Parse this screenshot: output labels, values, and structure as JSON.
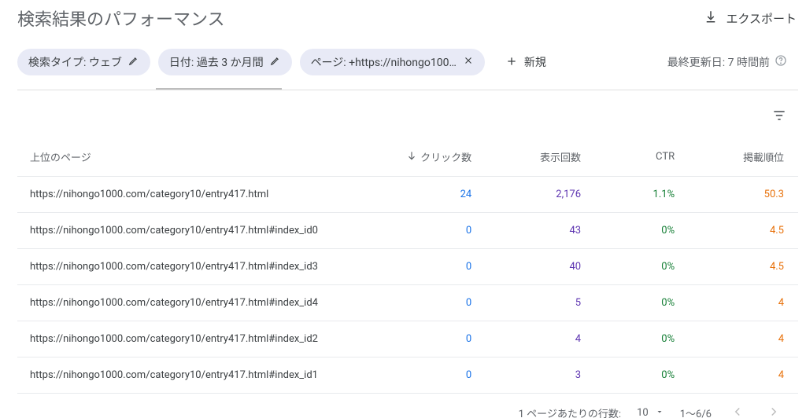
{
  "header": {
    "title": "検索結果のパフォーマンス",
    "export_label": "エクスポート"
  },
  "filters": {
    "search_type": "検索タイプ: ウェブ",
    "date_range": "日付: 過去 3 か月間",
    "page_filter": "ページ: +https://nihongo100…",
    "add_new": "新規",
    "last_updated": "最終更新日: 7 時間前"
  },
  "table": {
    "columns": {
      "page": "上位のページ",
      "clicks": "クリック数",
      "impressions": "表示回数",
      "ctr": "CTR",
      "position": "掲載順位"
    },
    "rows": [
      {
        "page": "https://nihongo1000.com/category10/entry417.html",
        "clicks": "24",
        "impressions": "2,176",
        "ctr": "1.1%",
        "position": "50.3"
      },
      {
        "page": "https://nihongo1000.com/category10/entry417.html#index_id0",
        "clicks": "0",
        "impressions": "43",
        "ctr": "0%",
        "position": "4.5"
      },
      {
        "page": "https://nihongo1000.com/category10/entry417.html#index_id3",
        "clicks": "0",
        "impressions": "40",
        "ctr": "0%",
        "position": "4.5"
      },
      {
        "page": "https://nihongo1000.com/category10/entry417.html#index_id4",
        "clicks": "0",
        "impressions": "5",
        "ctr": "0%",
        "position": "4"
      },
      {
        "page": "https://nihongo1000.com/category10/entry417.html#index_id2",
        "clicks": "0",
        "impressions": "4",
        "ctr": "0%",
        "position": "4"
      },
      {
        "page": "https://nihongo1000.com/category10/entry417.html#index_id1",
        "clicks": "0",
        "impressions": "3",
        "ctr": "0%",
        "position": "4"
      }
    ]
  },
  "pagination": {
    "rows_per_page_label": "1 ページあたりの行数:",
    "rows_per_page_value": "10",
    "range": "1～6/6"
  }
}
